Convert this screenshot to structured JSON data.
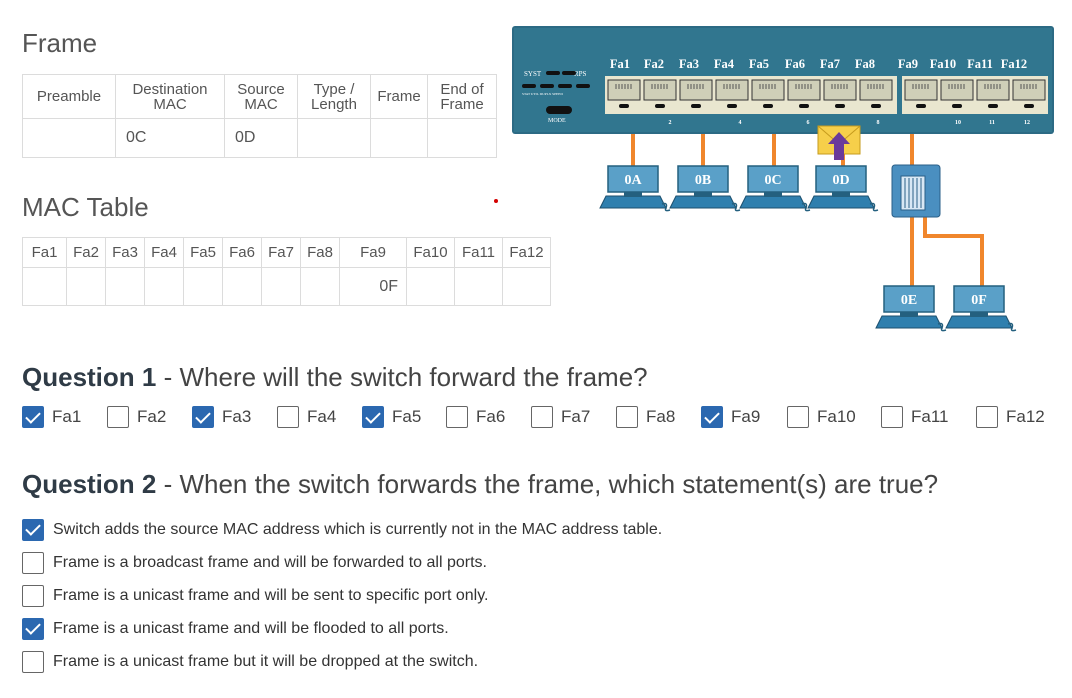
{
  "frame": {
    "title": "Frame",
    "headers": [
      "Preamble",
      "Destination MAC",
      "Source MAC",
      "Type / Length",
      "Frame",
      "End of Frame"
    ],
    "values": [
      "",
      "0C",
      "0D",
      "",
      "",
      ""
    ]
  },
  "mac_table": {
    "title": "MAC Table",
    "headers": [
      "Fa1",
      "Fa2",
      "Fa3",
      "Fa4",
      "Fa5",
      "Fa6",
      "Fa7",
      "Fa8",
      "Fa9",
      "Fa10",
      "Fa11",
      "Fa12"
    ],
    "values": [
      "",
      "",
      "",
      "",
      "",
      "",
      "",
      "",
      "0F",
      "",
      "",
      ""
    ]
  },
  "diagram": {
    "switch_labels": {
      "syst": "SYST",
      "rps": "RPS",
      "mode": "MODE",
      "small": "STAT  UTIL  DUPLX  SPEED"
    },
    "port_labels": [
      "Fa1",
      "Fa2",
      "Fa3",
      "Fa4",
      "Fa5",
      "Fa6",
      "Fa7",
      "Fa8",
      "Fa9",
      "Fa10",
      "Fa11",
      "Fa12"
    ],
    "port_numbers": [
      "2",
      "4",
      "6",
      "8",
      "10",
      "11",
      "12"
    ],
    "hosts": [
      "0A",
      "0B",
      "0C",
      "0D",
      "0E",
      "0F"
    ]
  },
  "question1": {
    "number": "Question 1",
    "text": " - Where will the switch forward the frame?",
    "options": [
      {
        "label": "Fa1",
        "checked": true
      },
      {
        "label": "Fa2",
        "checked": false
      },
      {
        "label": "Fa3",
        "checked": true
      },
      {
        "label": "Fa4",
        "checked": false
      },
      {
        "label": "Fa5",
        "checked": true
      },
      {
        "label": "Fa6",
        "checked": false
      },
      {
        "label": "Fa7",
        "checked": false
      },
      {
        "label": "Fa8",
        "checked": false
      },
      {
        "label": "Fa9",
        "checked": true
      },
      {
        "label": "Fa10",
        "checked": false
      },
      {
        "label": "Fa11",
        "checked": false
      },
      {
        "label": "Fa12",
        "checked": false
      }
    ]
  },
  "question2": {
    "number": "Question 2",
    "text": " - When the switch forwards the frame, which statement(s) are true?",
    "options": [
      {
        "label": "Switch adds the source MAC address which is currently not in the MAC address table.",
        "checked": true
      },
      {
        "label": "Frame is a broadcast frame and will be forwarded to all ports.",
        "checked": false
      },
      {
        "label": "Frame is a unicast frame and will be sent to specific port only.",
        "checked": false
      },
      {
        "label": "Frame is a unicast frame and will be flooded to all ports.",
        "checked": true
      },
      {
        "label": "Frame is a unicast frame but it will be dropped at the switch.",
        "checked": false
      }
    ]
  },
  "colors": {
    "accent": "#2b68b0",
    "switch": "#2f6e87",
    "cable": "#f0862c",
    "host": "#5aa0c8"
  }
}
